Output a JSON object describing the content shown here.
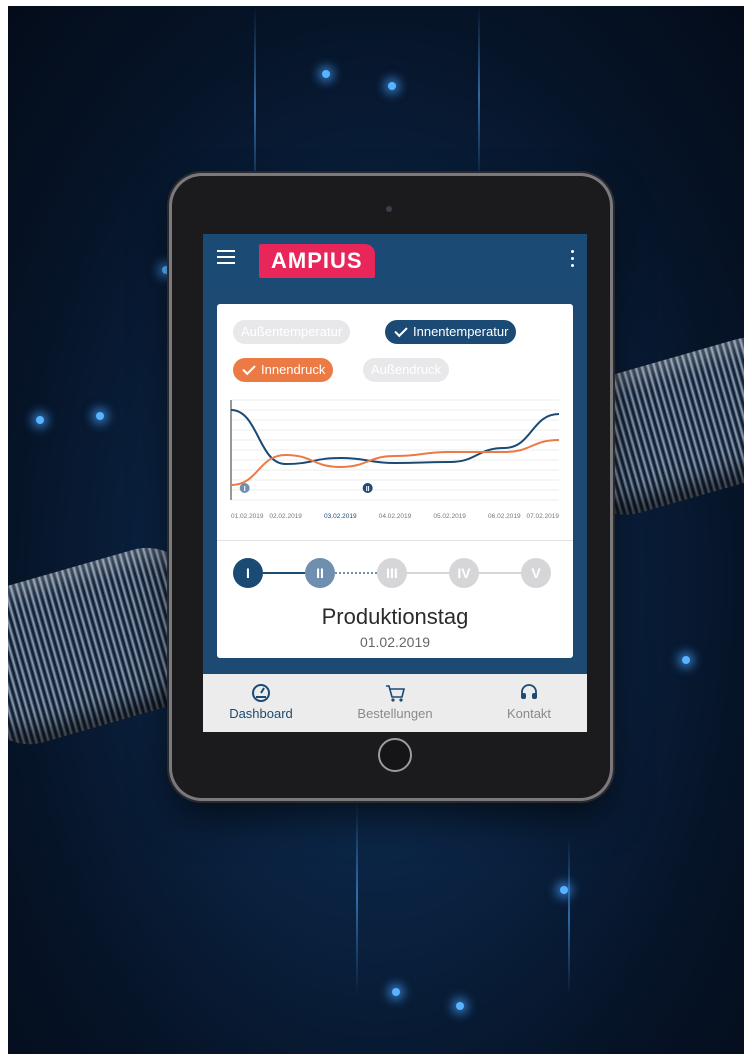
{
  "brand": {
    "logo_text": "AMPIUS",
    "accent": "#e8265a",
    "primary": "#1b4a74",
    "orange": "#ec7a44"
  },
  "app_bar": {
    "menu_icon": "hamburger-menu-icon",
    "more_icon": "more-vertical-icon"
  },
  "filters": [
    {
      "label": "Außentemperatur",
      "active": false
    },
    {
      "label": "Innentemperatur",
      "active": true,
      "color": "#1b4a74"
    },
    {
      "label": "Innendruck",
      "active": true,
      "color": "#ec7a44"
    },
    {
      "label": "Außendruck",
      "active": false
    }
  ],
  "chart_data": {
    "type": "line",
    "x": [
      "01.02.2019",
      "02.02.2019",
      "03.02.2019",
      "04.02.2019",
      "05.02.2019",
      "06.02.2019",
      "07.02.2019"
    ],
    "highlight_x": "03.02.2019",
    "series": [
      {
        "name": "Innentemperatur",
        "color": "#1b4a74",
        "values": [
          0.9,
          0.36,
          0.42,
          0.37,
          0.38,
          0.52,
          0.86
        ]
      },
      {
        "name": "Innendruck",
        "color": "#ec7a44",
        "values": [
          0.15,
          0.45,
          0.33,
          0.44,
          0.48,
          0.48,
          0.6
        ]
      }
    ],
    "markers": [
      {
        "label": "I",
        "x_index": 0.25
      },
      {
        "label": "II",
        "x_index": 2.5
      }
    ],
    "ylim": [
      0,
      1
    ],
    "grid": true
  },
  "stepper": {
    "steps": [
      {
        "label": "I",
        "state": "active"
      },
      {
        "label": "II",
        "state": "current"
      },
      {
        "label": "III",
        "state": "inactive"
      },
      {
        "label": "IV",
        "state": "inactive"
      },
      {
        "label": "V",
        "state": "inactive"
      }
    ]
  },
  "production": {
    "title": "Produktionstag",
    "date": "01.02.2019"
  },
  "bottom_nav": [
    {
      "label": "Dashboard",
      "icon": "gauge-icon",
      "active": true
    },
    {
      "label": "Bestellungen",
      "icon": "shopping-cart-icon",
      "active": false
    },
    {
      "label": "Kontakt",
      "icon": "headset-icon",
      "active": false
    }
  ]
}
